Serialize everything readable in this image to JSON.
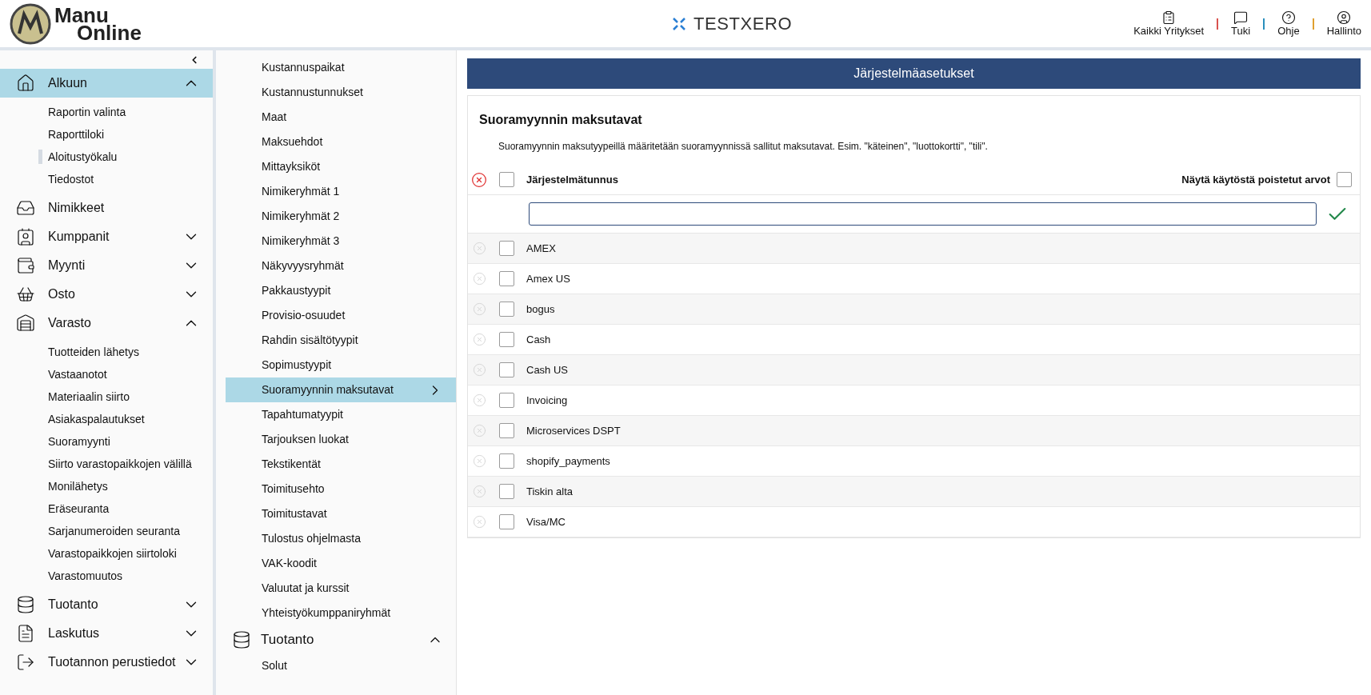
{
  "header": {
    "logo_line1": "Manu",
    "logo_line2": "Online",
    "company": "TESTXERO",
    "actions": [
      {
        "kind": "clipboard",
        "label": "Kaikki Yritykset"
      },
      {
        "kind": "chat",
        "label": "Tuki"
      },
      {
        "kind": "help",
        "label": "Ohje"
      },
      {
        "kind": "user",
        "label": "Hallinto"
      }
    ]
  },
  "sidebar": {
    "sections": [
      {
        "kind": "home",
        "label": "Alkuun",
        "selected": true,
        "expanded": true,
        "children": [
          {
            "label": "Raportin valinta",
            "current": false
          },
          {
            "label": "Raporttiloki",
            "current": false
          },
          {
            "label": "Aloitustyökalu",
            "current": true
          },
          {
            "label": "Tiedostot",
            "current": false
          }
        ]
      },
      {
        "kind": "inbox",
        "label": "Nimikkeet",
        "selected": false
      },
      {
        "kind": "contacts",
        "label": "Kumppanit",
        "selected": false,
        "expanded": false
      },
      {
        "kind": "wallet",
        "label": "Myynti",
        "selected": false,
        "expanded": false
      },
      {
        "kind": "basket",
        "label": "Osto",
        "selected": false,
        "expanded": false
      },
      {
        "kind": "warehouse",
        "label": "Varasto",
        "selected": false,
        "expanded": true,
        "children": [
          {
            "label": "Tuotteiden lähetys",
            "current": false
          },
          {
            "label": "Vastaanotot",
            "current": false
          },
          {
            "label": "Materiaalin siirto",
            "current": false
          },
          {
            "label": "Asiakaspalautukset",
            "current": false
          },
          {
            "label": "Suoramyynti",
            "current": false
          },
          {
            "label": "Siirto varastopaikkojen välillä",
            "current": false
          },
          {
            "label": "Monilähetys",
            "current": false
          },
          {
            "label": "Eräseuranta",
            "current": false
          },
          {
            "label": "Sarjanumeroiden seuranta",
            "current": false
          },
          {
            "label": "Varastopaikkojen siirtoloki",
            "current": false
          },
          {
            "label": "Varastomuutos",
            "current": false
          }
        ]
      },
      {
        "kind": "database",
        "label": "Tuotanto",
        "selected": false,
        "expanded": false
      },
      {
        "kind": "document",
        "label": "Laskutus",
        "selected": false,
        "expanded": false
      },
      {
        "kind": "exit",
        "label": "Tuotannon perustiedot",
        "selected": false,
        "expanded": false
      }
    ]
  },
  "settings_menu": {
    "items": [
      {
        "label": "Kustannuspaikat",
        "selected": false
      },
      {
        "label": "Kustannustunnukset",
        "selected": false
      },
      {
        "label": "Maat",
        "selected": false
      },
      {
        "label": "Maksuehdot",
        "selected": false
      },
      {
        "label": "Mittayksiköt",
        "selected": false
      },
      {
        "label": "Nimikeryhmät 1",
        "selected": false
      },
      {
        "label": "Nimikeryhmät 2",
        "selected": false
      },
      {
        "label": "Nimikeryhmät 3",
        "selected": false
      },
      {
        "label": "Näkyvyysryhmät",
        "selected": false
      },
      {
        "label": "Pakkaustyypit",
        "selected": false
      },
      {
        "label": "Provisio-osuudet",
        "selected": false
      },
      {
        "label": "Rahdin sisältötyypit",
        "selected": false
      },
      {
        "label": "Sopimustyypit",
        "selected": false
      },
      {
        "label": "Suoramyynnin maksutavat",
        "selected": true
      },
      {
        "label": "Tapahtumatyypit",
        "selected": false
      },
      {
        "label": "Tarjouksen luokat",
        "selected": false
      },
      {
        "label": "Tekstikentät",
        "selected": false
      },
      {
        "label": "Toimitusehto",
        "selected": false
      },
      {
        "label": "Toimitustavat",
        "selected": false
      },
      {
        "label": "Tulostus ohjelmasta",
        "selected": false
      },
      {
        "label": "VAK-koodit",
        "selected": false
      },
      {
        "label": "Valuutat ja kurssit",
        "selected": false
      },
      {
        "label": "Yhteistyökumppaniryhmät",
        "selected": false
      }
    ],
    "group": {
      "label": "Tuotanto",
      "expanded": true,
      "children": [
        {
          "label": "Solut"
        }
      ]
    }
  },
  "main": {
    "title": "Järjestelmäasetukset",
    "card_title": "Suoramyynnin maksutavat",
    "description": "Suoramyynnin maksutyypeillä määritetään suoramyynnissä sallitut maksutavat. Esim. \"käteinen\", \"luottokortti\", \"tili\".",
    "column": "Järjestelmätunnus",
    "select_all": false,
    "show_removed": {
      "label": "Näytä käytöstä poistetut arvot",
      "checked": false
    },
    "rows": [
      {
        "value": "AMEX",
        "checked": false
      },
      {
        "value": "Amex US",
        "checked": false
      },
      {
        "value": "bogus",
        "checked": false
      },
      {
        "value": "Cash",
        "checked": false
      },
      {
        "value": "Cash US",
        "checked": false
      },
      {
        "value": "Invoicing",
        "checked": false
      },
      {
        "value": "Microservices DSPT",
        "checked": false
      },
      {
        "value": "shopify_payments",
        "checked": false
      },
      {
        "value": "Tiskin alta",
        "checked": false
      },
      {
        "value": "Visa/MC",
        "checked": false
      }
    ]
  }
}
